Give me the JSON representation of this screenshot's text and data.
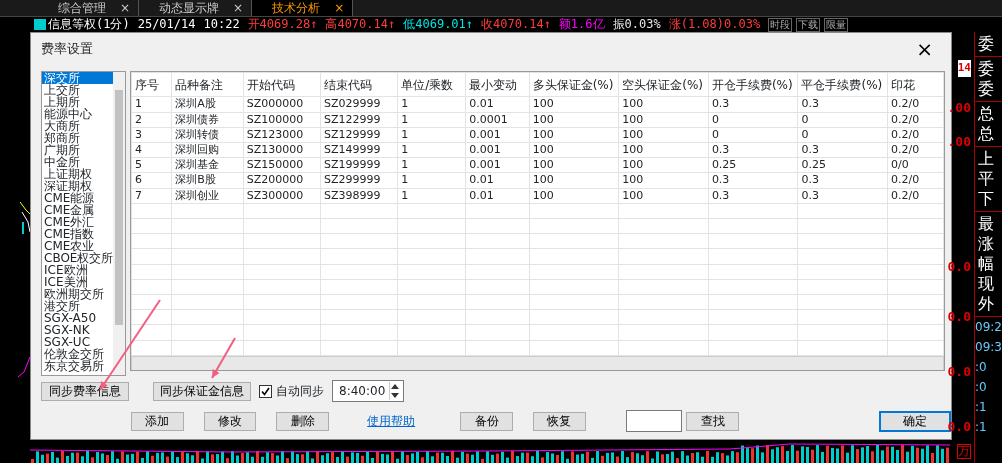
{
  "tabs": [
    {
      "label": "综合管理",
      "close": "×",
      "selected": false
    },
    {
      "label": "动态显示牌",
      "close": "×",
      "selected": false
    },
    {
      "label": "技术分析",
      "close": "×",
      "selected": true
    }
  ],
  "quote_bar": {
    "title": "信息等权(1分)",
    "date": "25/01/14",
    "time": "10:22",
    "fields": [
      {
        "text": "开4069.28",
        "arrow": "↑",
        "color": "#ff3c3c"
      },
      {
        "text": "高4070.14",
        "arrow": "↑",
        "color": "#ff3c3c"
      },
      {
        "text": "低4069.01",
        "arrow": "↑",
        "color": "#00e5e5"
      },
      {
        "text": "收4070.14",
        "arrow": "↑",
        "color": "#ff3c3c"
      },
      {
        "text": "额1.6亿",
        "color": "#ff00ff"
      },
      {
        "text": "振0.03%",
        "color": "#e6e6e6"
      },
      {
        "text": "涨(1.08)0.03%",
        "color": "#ff3c3c"
      }
    ],
    "tools": [
      "时段",
      "下载",
      "限量"
    ]
  },
  "dialog": {
    "title": "费率设置",
    "close": "×",
    "exchanges": [
      {
        "label": "深交所",
        "selected": true
      },
      {
        "label": "上交所",
        "selected": false
      },
      {
        "label": "上期所",
        "selected": false
      },
      {
        "label": "能源中心",
        "selected": false
      },
      {
        "label": "大商所",
        "selected": false
      },
      {
        "label": "郑商所",
        "selected": false
      },
      {
        "label": "广期所",
        "selected": false
      },
      {
        "label": "中金所",
        "selected": false
      },
      {
        "label": "上证期权",
        "selected": false
      },
      {
        "label": "深证期权",
        "selected": false
      },
      {
        "label": "CME能源",
        "selected": false
      },
      {
        "label": "CME金属",
        "selected": false
      },
      {
        "label": "CME外汇",
        "selected": false
      },
      {
        "label": "CME指数",
        "selected": false
      },
      {
        "label": "CME农业",
        "selected": false
      },
      {
        "label": "CBOE权交所",
        "selected": false
      },
      {
        "label": "ICE欧洲",
        "selected": false
      },
      {
        "label": "ICE美洲",
        "selected": false
      },
      {
        "label": "欧洲期交所",
        "selected": false
      },
      {
        "label": "港交所",
        "selected": false
      },
      {
        "label": "SGX-A50",
        "selected": false
      },
      {
        "label": "SGX-NK",
        "selected": false
      },
      {
        "label": "SGX-UC",
        "selected": false
      },
      {
        "label": "伦敦金交所",
        "selected": false
      },
      {
        "label": "东京交易所",
        "selected": false
      }
    ],
    "table": {
      "columns": [
        "序号",
        "品种备注",
        "开始代码",
        "结束代码",
        "单位/乘数",
        "最小变动",
        "多头保证金(%)",
        "空头保证金(%)",
        "开仓手续费(%)",
        "平仓手续费(%)",
        "印花"
      ],
      "rows": [
        [
          "1",
          "深圳A股",
          "SZ000000",
          "SZ029999",
          "1",
          "0.01",
          "100",
          "100",
          "0.3",
          "0.3",
          "0.2/0"
        ],
        [
          "2",
          "深圳债券",
          "SZ100000",
          "SZ122999",
          "1",
          "0.0001",
          "100",
          "100",
          "0",
          "0",
          "0.2/0"
        ],
        [
          "3",
          "深圳转债",
          "SZ123000",
          "SZ129999",
          "1",
          "0.001",
          "100",
          "100",
          "0",
          "0",
          "0.2/0"
        ],
        [
          "4",
          "深圳回购",
          "SZ130000",
          "SZ149999",
          "1",
          "0.001",
          "100",
          "100",
          "0.3",
          "0.3",
          "0.2/0"
        ],
        [
          "5",
          "深圳基金",
          "SZ150000",
          "SZ199999",
          "1",
          "0.001",
          "100",
          "100",
          "0.25",
          "0.25",
          "0/0"
        ],
        [
          "6",
          "深圳B股",
          "SZ200000",
          "SZ299999",
          "1",
          "0.01",
          "100",
          "100",
          "0.3",
          "0.3",
          "0.2/0"
        ],
        [
          "7",
          "深圳创业",
          "SZ300000",
          "SZ398999",
          "1",
          "0.01",
          "100",
          "100",
          "0.3",
          "0.3",
          "0.2/0"
        ]
      ]
    },
    "sync_buttons": [
      "同步费率信息",
      "同步保证金信息"
    ],
    "auto_sync": {
      "label": "自动同步",
      "checked": true
    },
    "sync_time": "8:40:00",
    "actions": [
      {
        "kind": "button",
        "label": "添加"
      },
      {
        "kind": "button",
        "label": "修改"
      },
      {
        "kind": "button",
        "label": "删除"
      },
      {
        "kind": "link",
        "label": "使用帮助"
      },
      {
        "kind": "button",
        "label": "备份"
      },
      {
        "kind": "button",
        "label": "恢复"
      },
      {
        "kind": "field"
      },
      {
        "kind": "button",
        "label": "查找"
      },
      {
        "kind": "primary",
        "label": "确定"
      }
    ]
  },
  "price_axis": [
    "14",
    ".00",
    ".00",
    "0.0",
    "0.0",
    "0.0",
    "0.0"
  ],
  "side_panel": {
    "groups": [
      [
        "委"
      ],
      [
        "委",
        "委"
      ],
      [
        "总",
        "总"
      ],
      [
        "上",
        "平",
        "下"
      ],
      [
        "最",
        "涨",
        "幅",
        "现",
        "外"
      ]
    ],
    "times": [
      "09:2",
      "09:3",
      ":0",
      ":0",
      ":1",
      ":1"
    ]
  },
  "volume_unit": "万"
}
